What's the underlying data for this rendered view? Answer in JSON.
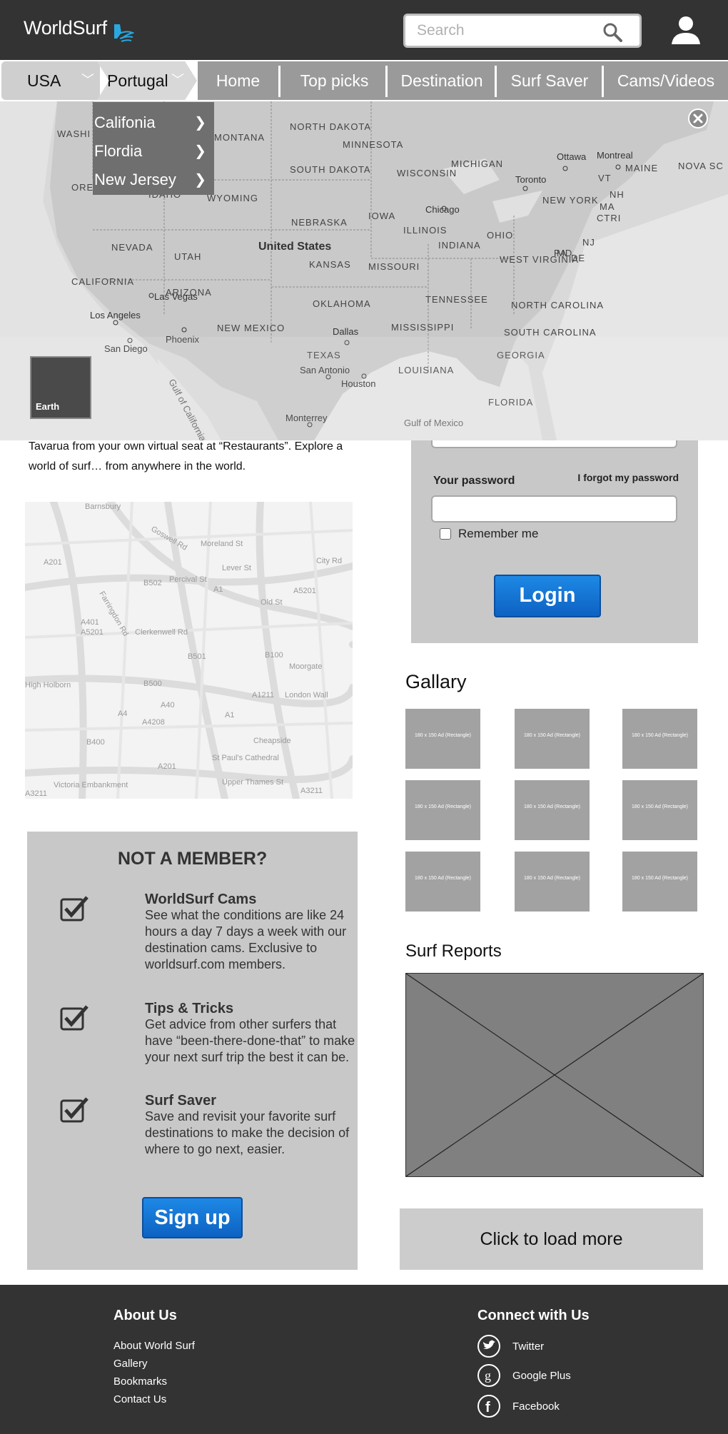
{
  "header": {
    "logo": "WorldSurf",
    "search_placeholder": "Search"
  },
  "nav": {
    "locations": [
      "USA",
      "Portugal"
    ],
    "items": [
      "Home",
      "Top picks",
      "Destination",
      "Surf Saver",
      "Cams/Videos"
    ]
  },
  "map": {
    "dropdown": [
      "Califonia",
      "Flordia",
      "New Jersey"
    ],
    "earth_label": "Earth",
    "country_label": "United States",
    "states": [
      "WASHI",
      "MONTANA",
      "NORTH DAKOTA",
      "MINNESOTA",
      "SOUTH DAKOTA",
      "WISCONSIN",
      "MICHIGAN",
      "MAINE",
      "NOVA SC",
      "VT",
      "NH",
      "MA",
      "CTRI",
      "NEW YORK",
      "ORE",
      "IDAHO",
      "WYOMING",
      "IOWA",
      "NEBRASKA",
      "ILLINOIS",
      "INDIANA",
      "OHIO",
      "PA",
      "NEVADA",
      "UTAH",
      "KANSAS",
      "MISSOURI",
      "WEST VIRGINIA",
      "NJ",
      "MD",
      "DE",
      "CALIFORNIA",
      "ARIZONA",
      "NEW MEXICO",
      "OKLAHOMA",
      "TENNESSEE",
      "NORTH CAROLINA",
      "MISSISSIPPI",
      "SOUTH CAROLINA",
      "TEXAS",
      "LOUISIANA",
      "GEORGIA",
      "FLORIDA"
    ],
    "cities": [
      "Ottawa",
      "Montreal",
      "Toronto",
      "Chicago",
      "Las Vegas",
      "Los Angeles",
      "Phoenix",
      "San Diego",
      "Dallas",
      "San Antonio",
      "Houston",
      "Monterrey"
    ],
    "water": [
      "Gulf of California",
      "Gulf of Mexico"
    ]
  },
  "intro": {
    "text": "Tavarua from your own virtual seat at “Restaurants”. Explore a world of surf… from anywhere in the world."
  },
  "street_map": {
    "labels": [
      "Barnsbury",
      "A201",
      "B502",
      "Percival St",
      "Lever St",
      "City Rd",
      "A1",
      "A5201",
      "A401",
      "A5201",
      "Clerkenwell Rd",
      "B501",
      "B100",
      "Moorgate",
      "B500",
      "A40",
      "A1211",
      "London Wall",
      "A4",
      "A4208",
      "A1",
      "High Holborn",
      "B400",
      "Cheapside",
      "A201",
      "St Paul's Cathedral",
      "Upper Thames St",
      "A3211",
      "Victoria Embankment",
      "A3211",
      "Old St",
      "Goswell Rd",
      "Moreland St",
      "Farringdon Rd"
    ]
  },
  "member": {
    "title": "NOT A MEMBER?",
    "features": [
      {
        "title": "WorldSurf Cams",
        "desc": "See what the conditions are like 24 hours a day 7 days a week with our destination cams. Exclusive to worldsurf.com members."
      },
      {
        "title": "Tips & Tricks",
        "desc": "Get advice from other surfers that have “been-there-done-that” to make your next surf trip the best it can be."
      },
      {
        "title": "Surf Saver",
        "desc": "Save and revisit your favorite surf destinations to make the decision of where to go next, easier."
      }
    ],
    "signup_label": "Sign up"
  },
  "login": {
    "password_label": "Your password",
    "forgot_label": "I forgot my password",
    "remember_label": "Remember me",
    "login_label": "Login"
  },
  "gallery": {
    "title": "Gallary",
    "thumb_label": "180 x 150 Ad (Rectangle)"
  },
  "reports": {
    "title": "Surf Reports",
    "load_more": "Click to load more"
  },
  "footer": {
    "about_heading": "About Us",
    "about_links": [
      "About World Surf",
      "Gallery",
      "Bookmarks",
      "Contact Us"
    ],
    "connect_heading": "Connect with Us",
    "social": [
      {
        "label": "Twitter",
        "icon": "twitter-icon"
      },
      {
        "label": "Google Plus",
        "icon": "google-plus-icon"
      },
      {
        "label": "Facebook",
        "icon": "facebook-icon"
      }
    ]
  },
  "colors": {
    "header_bg": "#333333",
    "nav_bg": "#9a9a9a",
    "panel_bg": "#c8c8c8",
    "button_blue": "#0d62c2",
    "accent_logo": "#29a8e0"
  }
}
